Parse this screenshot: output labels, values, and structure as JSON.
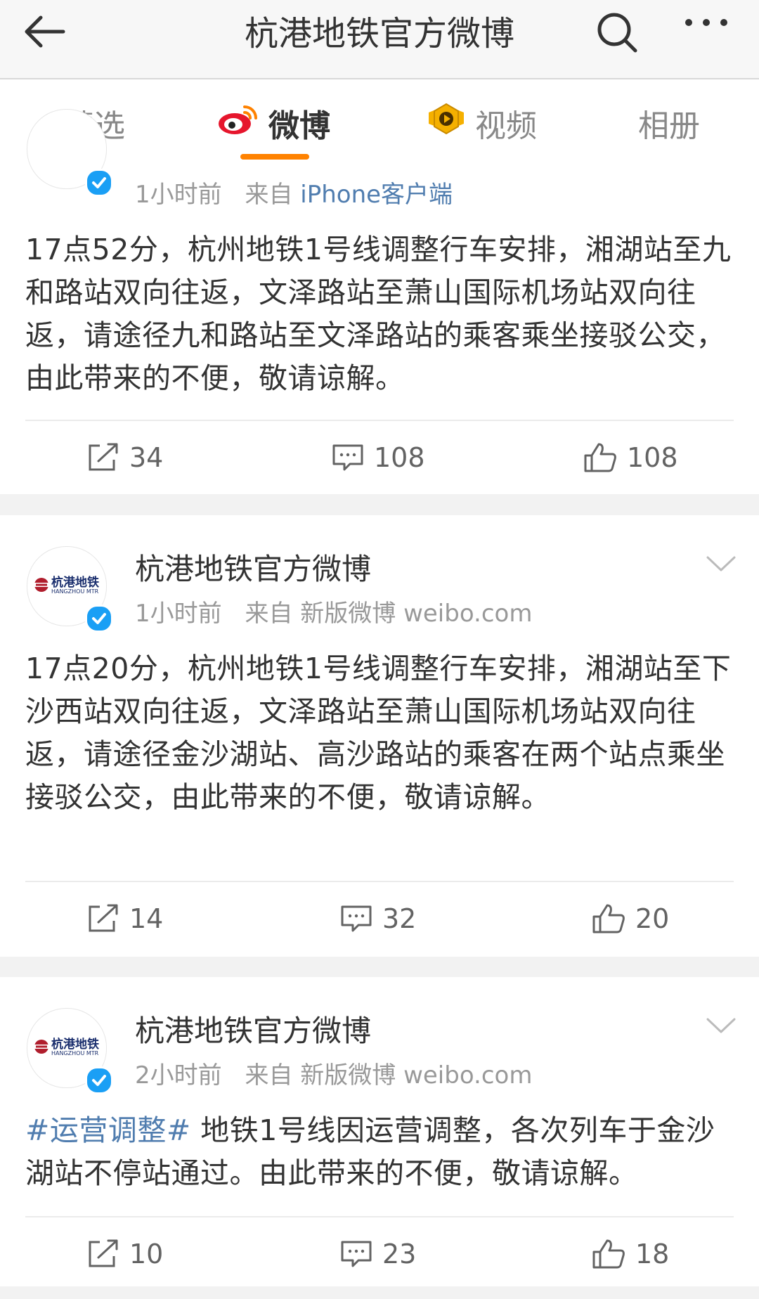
{
  "header": {
    "title": "杭港地铁官方微博",
    "back_icon": "back-arrow-icon",
    "search_icon": "search-icon",
    "more_icon": "more-dots-icon"
  },
  "tabs": [
    {
      "label": "精选",
      "active": false
    },
    {
      "label": "微博",
      "active": true,
      "icon": "weibo-logo-icon"
    },
    {
      "label": "视频",
      "active": false,
      "icon": "video-badge-icon"
    },
    {
      "label": "相册",
      "active": false
    }
  ],
  "accent_color": "#ff8200",
  "link_color": "#507daf",
  "posts": [
    {
      "time": "1小时前",
      "source_prefix": "来自",
      "source": "iPhone客户端",
      "text": "17点52分，杭州地铁1号线调整行车安排，湘湖站至九和路站双向往返，文泽路站至萧山国际机场站双向往返，请途径九和路站至文泽路站的乘客乘坐接驳公交，由此带来的不便，敬请谅解。",
      "reposts": "34",
      "comments": "108",
      "likes": "108"
    },
    {
      "author": "杭港地铁官方微博",
      "avatar_text": "杭港地铁",
      "avatar_subtext": "HANGZHOU MTR",
      "time": "1小时前",
      "source_prefix": "来自",
      "source": "新版微博 weibo.com",
      "text": "17点20分，杭州地铁1号线调整行车安排，湘湖站至下沙西站双向往返，文泽路站至萧山国际机场站双向往返，请途径金沙湖站、高沙路站的乘客在两个站点乘坐接驳公交，由此带来的不便，敬请谅解。",
      "reposts": "14",
      "comments": "32",
      "likes": "20"
    },
    {
      "author": "杭港地铁官方微博",
      "avatar_text": "杭港地铁",
      "avatar_subtext": "HANGZHOU MTR",
      "time": "2小时前",
      "source_prefix": "来自",
      "source": "新版微博 weibo.com",
      "hashtag": "#运营调整#",
      "text": "地铁1号线因运营调整，各次列车于金沙湖站不停站通过。由此带来的不便，敬请谅解。",
      "reposts": "10",
      "comments": "23",
      "likes": "18"
    }
  ]
}
